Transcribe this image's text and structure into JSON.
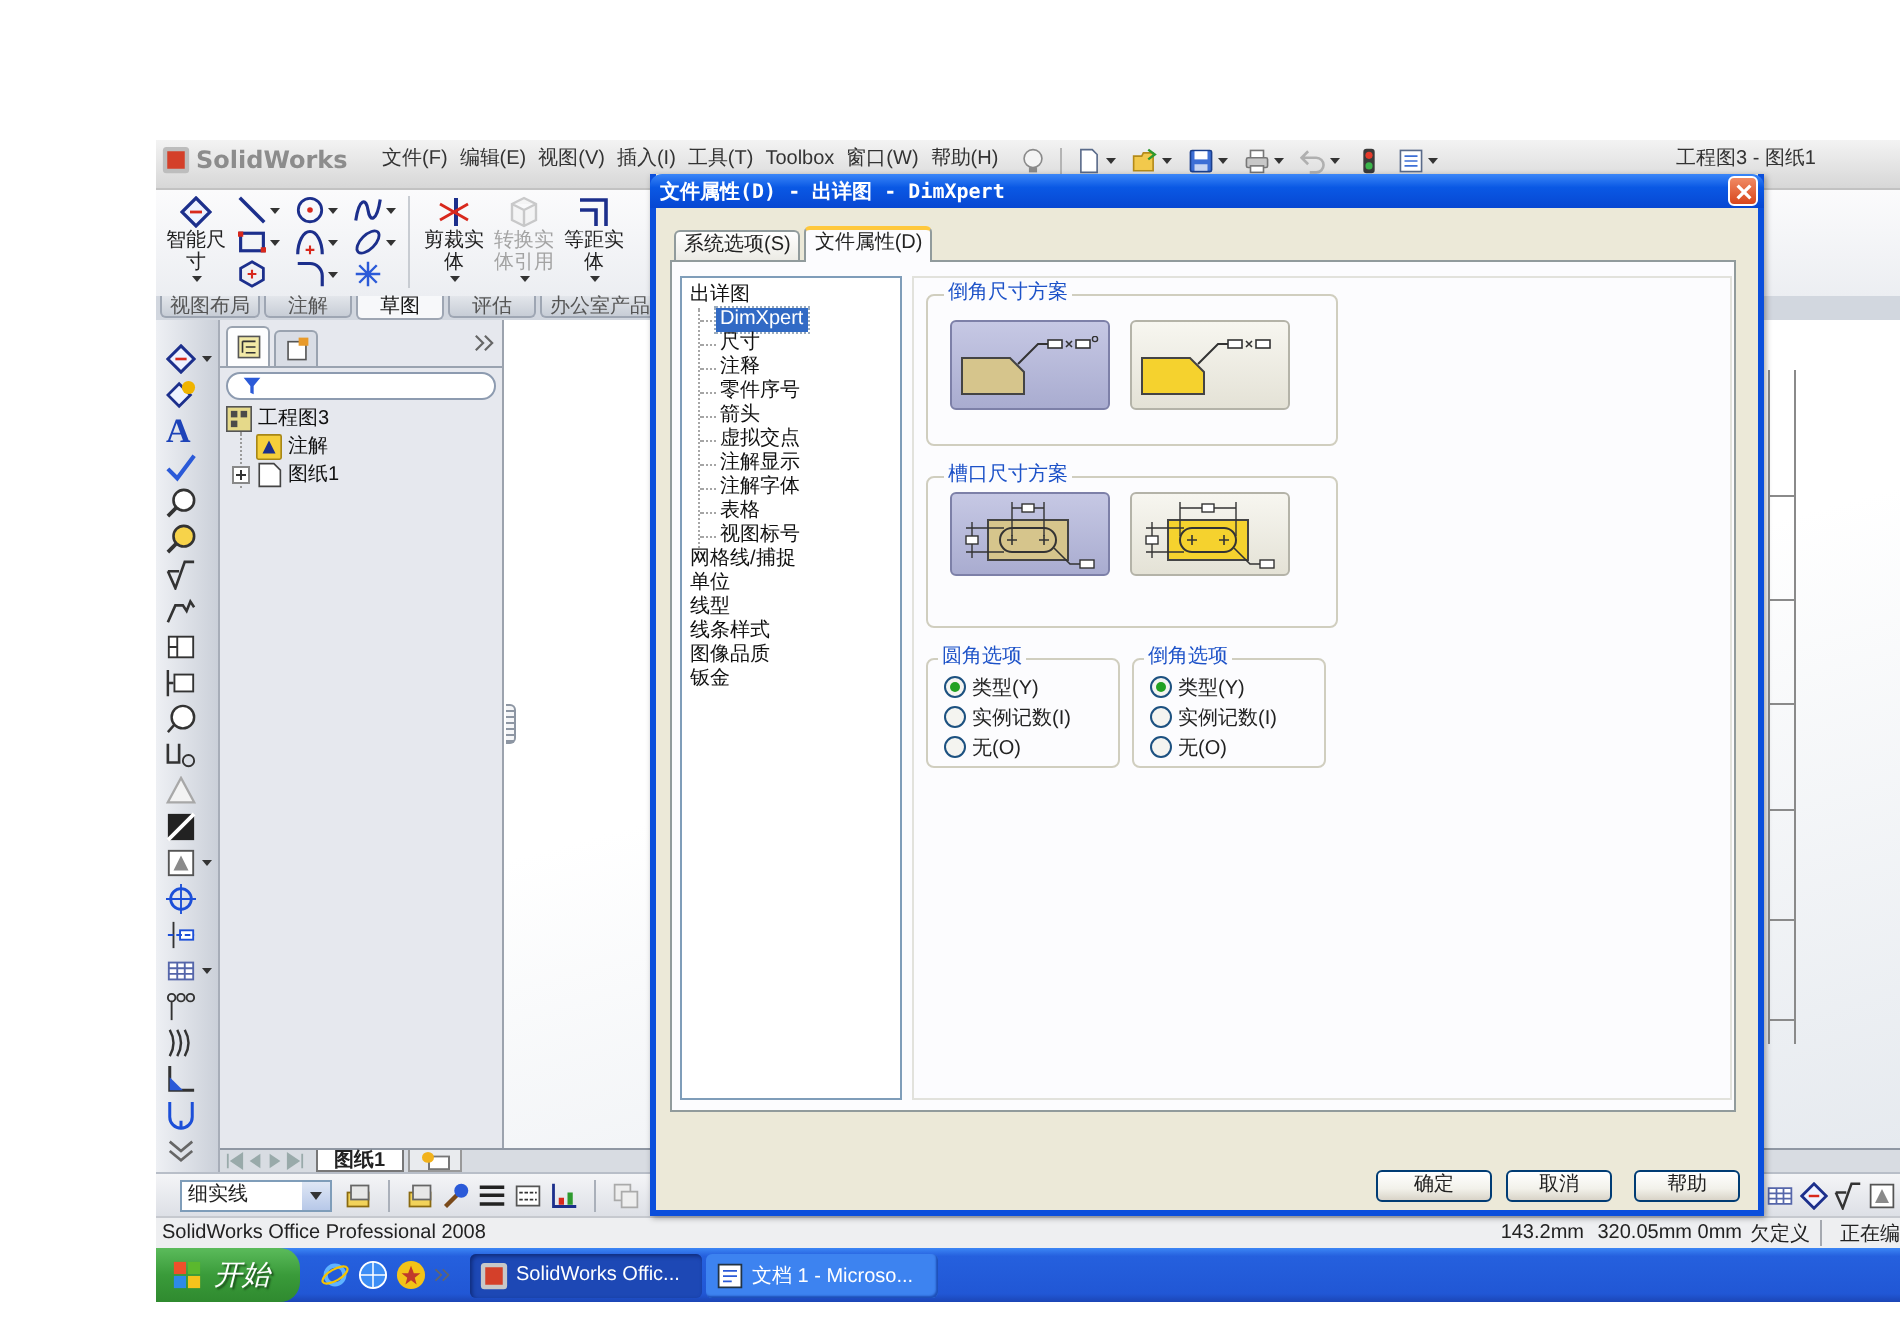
{
  "menu_bar": {
    "logo": "SolidWorks",
    "items": [
      "文件(F)",
      "编辑(E)",
      "视图(V)",
      "插入(I)",
      "工具(T)",
      "Toolbox",
      "窗口(W)",
      "帮助(H)"
    ],
    "document_title": "工程图3 - 图纸1"
  },
  "command_manager": {
    "commands": [
      {
        "label": "智能尺寸",
        "disabled": false
      },
      {
        "label": "剪裁实体",
        "disabled": false
      },
      {
        "label": "转换实体引用",
        "disabled": true
      },
      {
        "label": "等距实体",
        "disabled": false
      }
    ],
    "tabs": [
      {
        "label": "视图布局",
        "selected": false
      },
      {
        "label": "注解",
        "selected": false
      },
      {
        "label": "草图",
        "selected": true
      },
      {
        "label": "评估",
        "selected": false
      },
      {
        "label": "办公室产品",
        "selected": false
      }
    ]
  },
  "annotation_toolbar": {
    "note_glyph": "A"
  },
  "feature_manager": {
    "panel_tabs": [
      {
        "selected": true
      },
      {
        "selected": false
      }
    ],
    "tree": [
      {
        "label": "工程图3",
        "children": [
          {
            "label": "注解"
          },
          {
            "label": "图纸1",
            "expanded": false
          }
        ]
      }
    ]
  },
  "sheet_tabs": [
    {
      "label": "图纸1",
      "selected": true
    }
  ],
  "line_style": {
    "value": "细实线"
  },
  "status_bar": {
    "product": "SolidWorks Office Professional 2008",
    "fields": [
      "143.2mm",
      "320.05mm",
      "0mm",
      "欠定义",
      "正在编"
    ]
  },
  "taskbar": {
    "start": "开始",
    "tasks": [
      {
        "label": "SolidWorks Offic...",
        "selected": true
      },
      {
        "label": "文档 1 - Microso...",
        "selected": false
      }
    ]
  },
  "dialog": {
    "title": "文件属性(D) - 出详图 - DimXpert",
    "tabs": [
      {
        "label": "系统选项(S)",
        "selected": false
      },
      {
        "label": "文件属性(D)",
        "selected": true
      }
    ],
    "tree": [
      {
        "label": "出详图",
        "selected": false,
        "children": [
          {
            "label": "DimXpert",
            "selected": true
          },
          {
            "label": "尺寸",
            "selected": false
          },
          {
            "label": "注释",
            "selected": false
          },
          {
            "label": "零件序号",
            "selected": false
          },
          {
            "label": "箭头",
            "selected": false
          },
          {
            "label": "虚拟交点",
            "selected": false
          },
          {
            "label": "注解显示",
            "selected": false
          },
          {
            "label": "注解字体",
            "selected": false
          },
          {
            "label": "表格",
            "selected": false
          },
          {
            "label": "视图标号",
            "selected": false
          }
        ]
      },
      {
        "label": "网格线/捕捉",
        "selected": false
      },
      {
        "label": "单位",
        "selected": false
      },
      {
        "label": "线型",
        "selected": false
      },
      {
        "label": "线条样式",
        "selected": false
      },
      {
        "label": "图像品质",
        "selected": false
      },
      {
        "label": "钣金",
        "selected": false
      }
    ],
    "schemes": [
      {
        "title": "倒角尺寸方案",
        "kind": "chamfer",
        "options": [
          {
            "kind": "angle",
            "selected": true
          },
          {
            "kind": "distance",
            "selected": false
          }
        ]
      },
      {
        "title": "槽口尺寸方案",
        "kind": "slot",
        "options": [
          {
            "kind": "center",
            "selected": true
          },
          {
            "kind": "overall",
            "selected": false
          }
        ]
      }
    ],
    "radio_groups": [
      {
        "title": "圆角选项",
        "options": [
          {
            "label": "类型(Y)",
            "selected": true
          },
          {
            "label": "实例记数(I)",
            "selected": false
          },
          {
            "label": "无(O)",
            "selected": false
          }
        ]
      },
      {
        "title": "倒角选项",
        "options": [
          {
            "label": "类型(Y)",
            "selected": true
          },
          {
            "label": "实例记数(I)",
            "selected": false
          },
          {
            "label": "无(O)",
            "selected": false
          }
        ]
      }
    ],
    "buttons": [
      "确定",
      "取消",
      "帮助"
    ]
  }
}
